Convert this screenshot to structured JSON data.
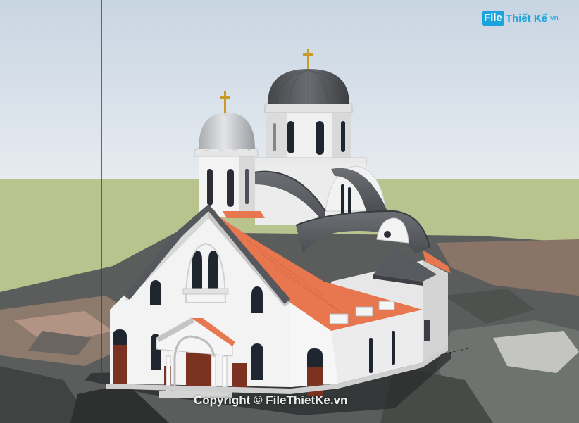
{
  "watermark": {
    "logo_box": "File",
    "logo_rest": "Thiết Kế",
    "logo_ext": ".vn",
    "copyright": "Copyright © FileThietKe.vn"
  },
  "colors": {
    "sky_top": "#c9d6e3",
    "sky_bottom": "#e4eaf0",
    "grass": "#b9c48f",
    "wall": "#f1f1f1",
    "wall_shade": "#d9d9d9",
    "roof_orange": "#e8764e",
    "roof_gray": "#5d6063",
    "dome_dark": "#54575b",
    "dome_silver": "#bfc2c5",
    "cross_gold": "#c79a2a",
    "door": "#7b3220",
    "axis_blue": "#2b2bcc",
    "logo_blue": "#1aa3dc"
  },
  "icons": [
    "cross-icon"
  ]
}
